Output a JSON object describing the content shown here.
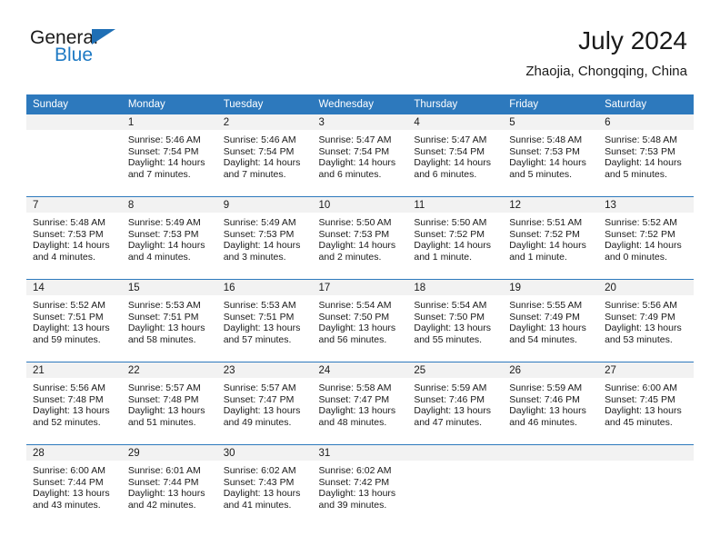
{
  "brand": {
    "name_top": "General",
    "name_bottom": "Blue",
    "accent_color": "#1f7ac4"
  },
  "header": {
    "title": "July 2024",
    "subtitle": "Zhaojia, Chongqing, China"
  },
  "theme": {
    "header_row_color": "#2d79bd",
    "daynum_band_color": "#f2f2f2",
    "text_color": "#1a1a1a"
  },
  "weekday_headers": [
    "Sunday",
    "Monday",
    "Tuesday",
    "Wednesday",
    "Thursday",
    "Friday",
    "Saturday"
  ],
  "weeks": [
    [
      {
        "day": "",
        "sunrise": "",
        "sunset": "",
        "daylight1": "",
        "daylight2": "",
        "empty": true
      },
      {
        "day": "1",
        "sunrise": "Sunrise: 5:46 AM",
        "sunset": "Sunset: 7:54 PM",
        "daylight1": "Daylight: 14 hours",
        "daylight2": "and 7 minutes."
      },
      {
        "day": "2",
        "sunrise": "Sunrise: 5:46 AM",
        "sunset": "Sunset: 7:54 PM",
        "daylight1": "Daylight: 14 hours",
        "daylight2": "and 7 minutes."
      },
      {
        "day": "3",
        "sunrise": "Sunrise: 5:47 AM",
        "sunset": "Sunset: 7:54 PM",
        "daylight1": "Daylight: 14 hours",
        "daylight2": "and 6 minutes."
      },
      {
        "day": "4",
        "sunrise": "Sunrise: 5:47 AM",
        "sunset": "Sunset: 7:54 PM",
        "daylight1": "Daylight: 14 hours",
        "daylight2": "and 6 minutes."
      },
      {
        "day": "5",
        "sunrise": "Sunrise: 5:48 AM",
        "sunset": "Sunset: 7:53 PM",
        "daylight1": "Daylight: 14 hours",
        "daylight2": "and 5 minutes."
      },
      {
        "day": "6",
        "sunrise": "Sunrise: 5:48 AM",
        "sunset": "Sunset: 7:53 PM",
        "daylight1": "Daylight: 14 hours",
        "daylight2": "and 5 minutes."
      }
    ],
    [
      {
        "day": "7",
        "sunrise": "Sunrise: 5:48 AM",
        "sunset": "Sunset: 7:53 PM",
        "daylight1": "Daylight: 14 hours",
        "daylight2": "and 4 minutes."
      },
      {
        "day": "8",
        "sunrise": "Sunrise: 5:49 AM",
        "sunset": "Sunset: 7:53 PM",
        "daylight1": "Daylight: 14 hours",
        "daylight2": "and 4 minutes."
      },
      {
        "day": "9",
        "sunrise": "Sunrise: 5:49 AM",
        "sunset": "Sunset: 7:53 PM",
        "daylight1": "Daylight: 14 hours",
        "daylight2": "and 3 minutes."
      },
      {
        "day": "10",
        "sunrise": "Sunrise: 5:50 AM",
        "sunset": "Sunset: 7:53 PM",
        "daylight1": "Daylight: 14 hours",
        "daylight2": "and 2 minutes."
      },
      {
        "day": "11",
        "sunrise": "Sunrise: 5:50 AM",
        "sunset": "Sunset: 7:52 PM",
        "daylight1": "Daylight: 14 hours",
        "daylight2": "and 1 minute."
      },
      {
        "day": "12",
        "sunrise": "Sunrise: 5:51 AM",
        "sunset": "Sunset: 7:52 PM",
        "daylight1": "Daylight: 14 hours",
        "daylight2": "and 1 minute."
      },
      {
        "day": "13",
        "sunrise": "Sunrise: 5:52 AM",
        "sunset": "Sunset: 7:52 PM",
        "daylight1": "Daylight: 14 hours",
        "daylight2": "and 0 minutes."
      }
    ],
    [
      {
        "day": "14",
        "sunrise": "Sunrise: 5:52 AM",
        "sunset": "Sunset: 7:51 PM",
        "daylight1": "Daylight: 13 hours",
        "daylight2": "and 59 minutes."
      },
      {
        "day": "15",
        "sunrise": "Sunrise: 5:53 AM",
        "sunset": "Sunset: 7:51 PM",
        "daylight1": "Daylight: 13 hours",
        "daylight2": "and 58 minutes."
      },
      {
        "day": "16",
        "sunrise": "Sunrise: 5:53 AM",
        "sunset": "Sunset: 7:51 PM",
        "daylight1": "Daylight: 13 hours",
        "daylight2": "and 57 minutes."
      },
      {
        "day": "17",
        "sunrise": "Sunrise: 5:54 AM",
        "sunset": "Sunset: 7:50 PM",
        "daylight1": "Daylight: 13 hours",
        "daylight2": "and 56 minutes."
      },
      {
        "day": "18",
        "sunrise": "Sunrise: 5:54 AM",
        "sunset": "Sunset: 7:50 PM",
        "daylight1": "Daylight: 13 hours",
        "daylight2": "and 55 minutes."
      },
      {
        "day": "19",
        "sunrise": "Sunrise: 5:55 AM",
        "sunset": "Sunset: 7:49 PM",
        "daylight1": "Daylight: 13 hours",
        "daylight2": "and 54 minutes."
      },
      {
        "day": "20",
        "sunrise": "Sunrise: 5:56 AM",
        "sunset": "Sunset: 7:49 PM",
        "daylight1": "Daylight: 13 hours",
        "daylight2": "and 53 minutes."
      }
    ],
    [
      {
        "day": "21",
        "sunrise": "Sunrise: 5:56 AM",
        "sunset": "Sunset: 7:48 PM",
        "daylight1": "Daylight: 13 hours",
        "daylight2": "and 52 minutes."
      },
      {
        "day": "22",
        "sunrise": "Sunrise: 5:57 AM",
        "sunset": "Sunset: 7:48 PM",
        "daylight1": "Daylight: 13 hours",
        "daylight2": "and 51 minutes."
      },
      {
        "day": "23",
        "sunrise": "Sunrise: 5:57 AM",
        "sunset": "Sunset: 7:47 PM",
        "daylight1": "Daylight: 13 hours",
        "daylight2": "and 49 minutes."
      },
      {
        "day": "24",
        "sunrise": "Sunrise: 5:58 AM",
        "sunset": "Sunset: 7:47 PM",
        "daylight1": "Daylight: 13 hours",
        "daylight2": "and 48 minutes."
      },
      {
        "day": "25",
        "sunrise": "Sunrise: 5:59 AM",
        "sunset": "Sunset: 7:46 PM",
        "daylight1": "Daylight: 13 hours",
        "daylight2": "and 47 minutes."
      },
      {
        "day": "26",
        "sunrise": "Sunrise: 5:59 AM",
        "sunset": "Sunset: 7:46 PM",
        "daylight1": "Daylight: 13 hours",
        "daylight2": "and 46 minutes."
      },
      {
        "day": "27",
        "sunrise": "Sunrise: 6:00 AM",
        "sunset": "Sunset: 7:45 PM",
        "daylight1": "Daylight: 13 hours",
        "daylight2": "and 45 minutes."
      }
    ],
    [
      {
        "day": "28",
        "sunrise": "Sunrise: 6:00 AM",
        "sunset": "Sunset: 7:44 PM",
        "daylight1": "Daylight: 13 hours",
        "daylight2": "and 43 minutes."
      },
      {
        "day": "29",
        "sunrise": "Sunrise: 6:01 AM",
        "sunset": "Sunset: 7:44 PM",
        "daylight1": "Daylight: 13 hours",
        "daylight2": "and 42 minutes."
      },
      {
        "day": "30",
        "sunrise": "Sunrise: 6:02 AM",
        "sunset": "Sunset: 7:43 PM",
        "daylight1": "Daylight: 13 hours",
        "daylight2": "and 41 minutes."
      },
      {
        "day": "31",
        "sunrise": "Sunrise: 6:02 AM",
        "sunset": "Sunset: 7:42 PM",
        "daylight1": "Daylight: 13 hours",
        "daylight2": "and 39 minutes."
      },
      {
        "day": "",
        "sunrise": "",
        "sunset": "",
        "daylight1": "",
        "daylight2": "",
        "empty": true
      },
      {
        "day": "",
        "sunrise": "",
        "sunset": "",
        "daylight1": "",
        "daylight2": "",
        "empty": true
      },
      {
        "day": "",
        "sunrise": "",
        "sunset": "",
        "daylight1": "",
        "daylight2": "",
        "empty": true
      }
    ]
  ]
}
